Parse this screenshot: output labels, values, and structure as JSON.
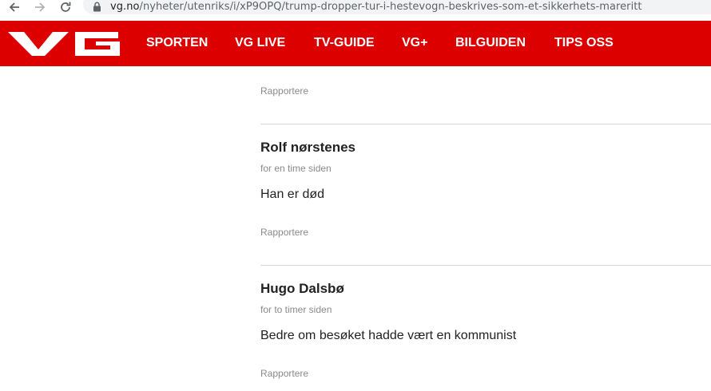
{
  "browser": {
    "url_host": "vg.no",
    "url_path": "/nyheter/utenriks/i/xP9OPQ/trump-dropper-tur-i-hestevogn-beskrives-som-et-sikkerhets-mareritt",
    "icons": [
      "back-icon",
      "forward-icon",
      "reload-icon",
      "lock-icon"
    ]
  },
  "header": {
    "logo_text": "VG",
    "brand_color": "#dd0000",
    "menu": [
      "SPORTEN",
      "VG LIVE",
      "TV-GUIDE",
      "VG+",
      "BILGUIDEN",
      "TIPS OSS"
    ]
  },
  "comments": {
    "top_report_label": "Rapportere",
    "items": [
      {
        "author": "Rolf nørstenes",
        "time": "for en time siden",
        "text": "Han er død",
        "report_label": "Rapportere"
      },
      {
        "author": "Hugo Dalsbø",
        "time": "for to timer siden",
        "text": "Bedre om besøket hadde vært en kommunist",
        "report_label": "Rapportere"
      }
    ]
  }
}
